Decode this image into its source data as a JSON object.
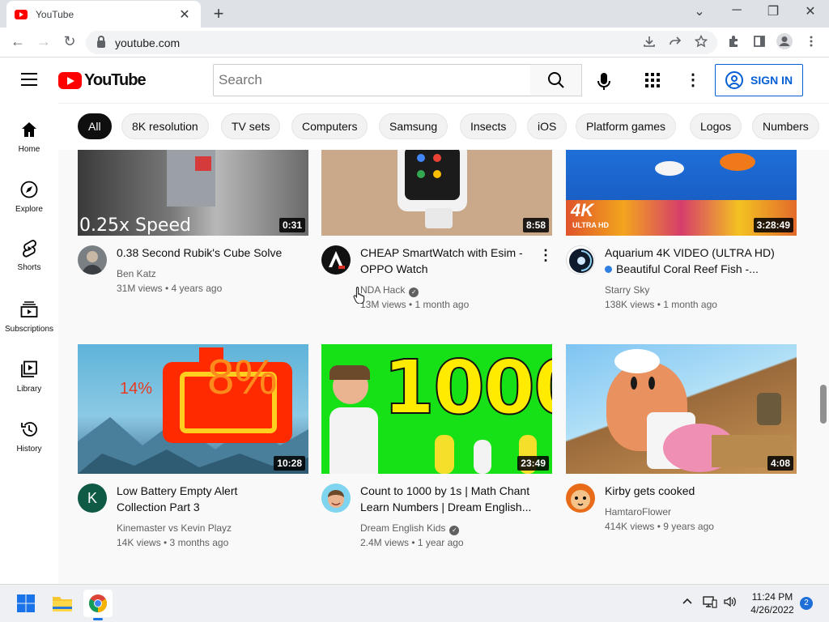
{
  "browser": {
    "tab_title": "YouTube",
    "tab_close": "✕",
    "new_tab": "+",
    "window_controls": [
      "⌄",
      "─",
      "❐",
      "✕"
    ],
    "nav": {
      "back": "←",
      "forward": "→",
      "reload": "↻"
    },
    "url": "youtube.com",
    "toolbar_icons": [
      "download-icon",
      "share-icon",
      "bookmark-star-icon",
      "extensions-icon",
      "sidepanel-icon",
      "profile-icon",
      "menu-icon"
    ]
  },
  "header": {
    "logo_text": "YouTube",
    "search_placeholder": "Search",
    "signin_label": "SIGN IN",
    "more": "⋮"
  },
  "guide": [
    {
      "label": "Home",
      "icon": "home-icon"
    },
    {
      "label": "Explore",
      "icon": "compass-icon"
    },
    {
      "label": "Shorts",
      "icon": "shorts-icon"
    },
    {
      "label": "Subscriptions",
      "icon": "subscriptions-icon"
    },
    {
      "label": "Library",
      "icon": "library-icon"
    },
    {
      "label": "History",
      "icon": "history-icon"
    }
  ],
  "chips": [
    "All",
    "8K resolution",
    "TV sets",
    "Computers",
    "Samsung",
    "Insects",
    "iOS",
    "Platform games",
    "Logos",
    "Numbers"
  ],
  "videos": [
    {
      "title_line1": "0.38 Second Rubik's Cube Solve",
      "title_line2": "",
      "channel": "Ben Katz",
      "verified": false,
      "meta": "31M views • 4 years ago",
      "duration": "0:31",
      "thumb_caption": "0.25x Speed"
    },
    {
      "title_line1": "CHEAP SmartWatch with Esim -",
      "title_line2": "OPPO Watch",
      "channel": "NDA Hack",
      "verified": true,
      "meta": "13M views • 1 month ago",
      "duration": "8:58",
      "avatar_text": "A"
    },
    {
      "title_line1": "Aquarium 4K VIDEO (ULTRA HD)",
      "title_line2": "Beautiful Coral Reef Fish -...",
      "channel": "Starry Sky",
      "verified": false,
      "meta": "138K views • 1 month ago",
      "duration": "3:28:49",
      "thumb_caption": "4K",
      "thumb_caption2": "ULTRA HD"
    },
    {
      "title_line1": "Low Battery Empty Alert",
      "title_line2": "Collection Part 3",
      "channel": "Kinemaster vs Kevin Playz",
      "verified": false,
      "meta": "14K views • 3 months ago",
      "duration": "10:28",
      "avatar_text": "K",
      "thumb_caption": "14%",
      "thumb_caption2": "8%"
    },
    {
      "title_line1": "Count to 1000 by 1s | Math Chant",
      "title_line2": "Learn Numbers | Dream English...",
      "channel": "Dream English Kids",
      "verified": true,
      "meta": "2.4M views • 1 year ago",
      "duration": "23:49",
      "thumb_caption": "1000"
    },
    {
      "title_line1": "Kirby gets cooked",
      "title_line2": "",
      "channel": "HamtaroFlower",
      "verified": false,
      "meta": "414K views • 9 years ago",
      "duration": "4:08"
    }
  ],
  "taskbar": {
    "time": "11:24 PM",
    "date": "4/26/2022",
    "notifications": "2",
    "apps": [
      "windows-start-icon",
      "file-explorer-icon",
      "chrome-icon"
    ]
  },
  "colors": {
    "brand_red": "#ff0000",
    "signin_blue": "#065fd4",
    "chip_active": "#0f0f0f",
    "chip_bg": "#f2f2f2"
  }
}
